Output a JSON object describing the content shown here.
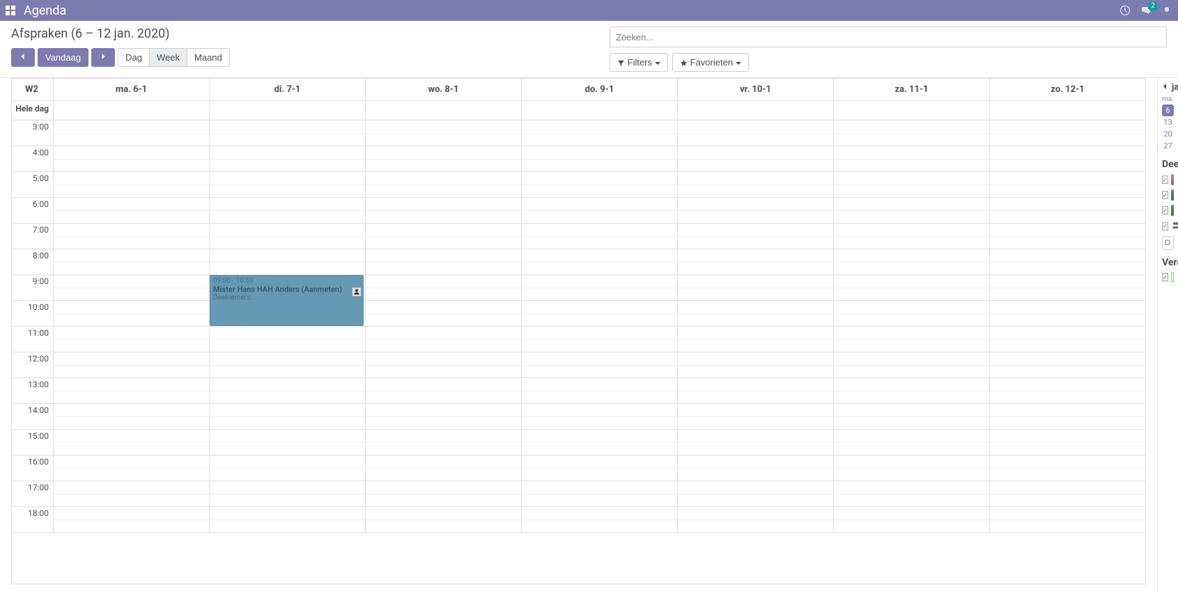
{
  "navbar": {
    "title": "Agenda",
    "msg_badge": "2"
  },
  "cp": {
    "title": "Afspraken (6 – 12 jan. 2020)",
    "today": "Vandaag",
    "view_day": "Dag",
    "view_week": "Week",
    "view_month": "Maand",
    "search_placeholder": "Zoeken...",
    "filters": "Filters",
    "favorites": "Favorieten"
  },
  "cal": {
    "week_label": "W2",
    "allday_label": "Hele dag",
    "days": [
      "ma. 6-1",
      "di. 7-1",
      "wo. 8-1",
      "do. 9-1",
      "vr. 10-1",
      "za. 11-1",
      "zo. 12-1"
    ],
    "hours": [
      "3:00",
      "4:00",
      "5:00",
      "6:00",
      "7:00",
      "8:00",
      "9:00",
      "10:00",
      "11:00",
      "12:00",
      "13:00",
      "14:00",
      "15:00",
      "16:00",
      "17:00",
      "18:00"
    ]
  },
  "event": {
    "time": "09:00 - 10:59",
    "title": "Mister Hans HAH Anders (Aanmeten)",
    "attendees": "Deelnemers:"
  },
  "side": {
    "month_header": "ja",
    "dayh": "ma.",
    "days": [
      "6",
      "13",
      "20",
      "27"
    ],
    "h_attendees": "Dee",
    "h_responsible": "Vera",
    "add_placeholder": "Dee"
  }
}
